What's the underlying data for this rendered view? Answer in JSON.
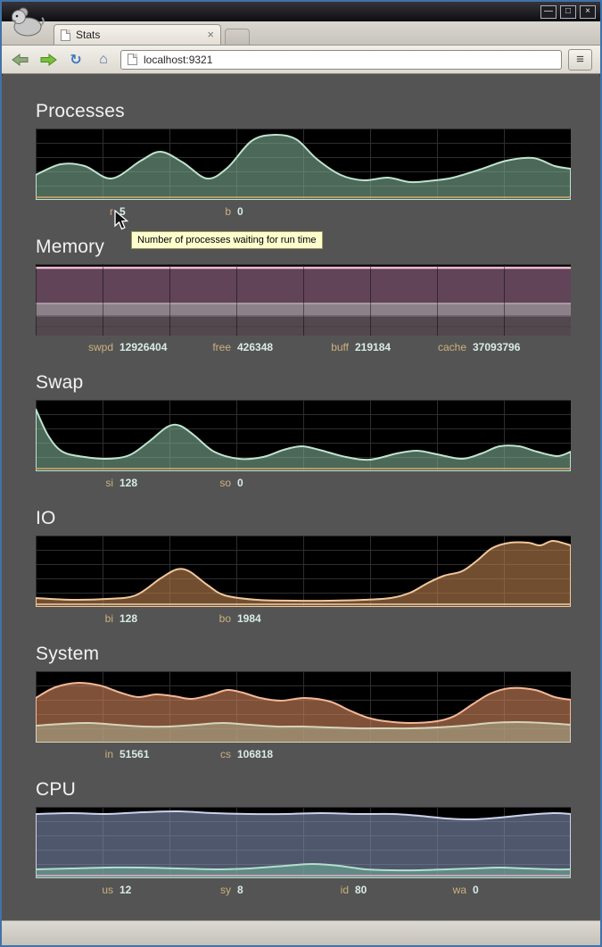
{
  "window": {
    "controls": {
      "minimize": "—",
      "maximize": "□",
      "close": "×"
    }
  },
  "browser": {
    "tab": {
      "title": "Stats",
      "close_icon": "×"
    },
    "url": "localhost:9321",
    "menu_icon": "≡",
    "reload_icon": "↻",
    "home_icon": "⌂"
  },
  "tooltip": "Number of processes waiting for run time",
  "sections": [
    {
      "title": "Processes",
      "chart_type": "area",
      "stats": [
        {
          "label": "r",
          "value": "5"
        },
        {
          "label": "b",
          "value": "0"
        }
      ],
      "series_colors": [
        {
          "fill": "rgba(127,174,146,0.6)",
          "stroke": "#bfe3cf"
        },
        {
          "fill": "none",
          "stroke": "#d9a871"
        }
      ]
    },
    {
      "title": "Memory",
      "chart_type": "stacked-area",
      "stats": [
        {
          "label": "swpd",
          "value": "12926404"
        },
        {
          "label": "free",
          "value": "426348"
        },
        {
          "label": "buff",
          "value": "219184"
        },
        {
          "label": "cache",
          "value": "37093796"
        }
      ],
      "band_colors": [
        "#614457",
        "#8d8189",
        "#52484e",
        "#eebcd2"
      ]
    },
    {
      "title": "Swap",
      "chart_type": "area",
      "stats": [
        {
          "label": "si",
          "value": "128"
        },
        {
          "label": "so",
          "value": "0"
        }
      ],
      "series_colors": [
        {
          "fill": "rgba(127,174,146,0.6)",
          "stroke": "#bfe3cf"
        },
        {
          "fill": "none",
          "stroke": "#d9a871"
        }
      ]
    },
    {
      "title": "IO",
      "chart_type": "area",
      "stats": [
        {
          "label": "bi",
          "value": "128"
        },
        {
          "label": "bo",
          "value": "1984"
        }
      ],
      "series_colors": [
        {
          "fill": "rgba(190,130,80,0.6)",
          "stroke": "#f2c79b"
        },
        {
          "fill": "none",
          "stroke": "#e8d2ae"
        }
      ]
    },
    {
      "title": "System",
      "chart_type": "area",
      "stats": [
        {
          "label": "in",
          "value": "51561"
        },
        {
          "label": "cs",
          "value": "106818"
        }
      ],
      "series_colors": [
        {
          "fill": "rgba(205,130,90,0.62)",
          "stroke": "#f4b896"
        },
        {
          "fill": "rgba(170,170,140,0.6)",
          "stroke": "#d6d4ba"
        }
      ]
    },
    {
      "title": "CPU",
      "chart_type": "area",
      "stats": [
        {
          "label": "us",
          "value": "12"
        },
        {
          "label": "sy",
          "value": "8"
        },
        {
          "label": "id",
          "value": "80"
        },
        {
          "label": "wa",
          "value": "0"
        }
      ],
      "series_colors": [
        {
          "fill": "rgba(130,145,180,0.6)",
          "stroke": "#ccd2ea"
        },
        {
          "fill": "rgba(110,170,150,0.6)",
          "stroke": "#b2dfcd"
        },
        {
          "fill": "none",
          "stroke": "#eaaec4"
        }
      ]
    }
  ]
}
